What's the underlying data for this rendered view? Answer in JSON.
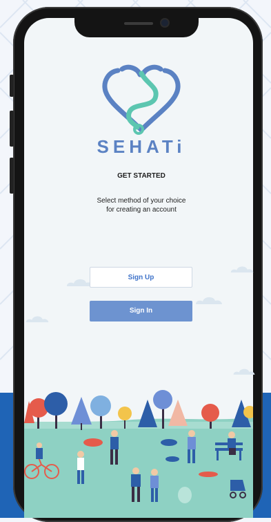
{
  "app": {
    "brand": "SEHATi",
    "title": "GET STARTED",
    "subtitle_line1": "Select method of your choice",
    "subtitle_line2": "for creating an account"
  },
  "buttons": {
    "sign_up": "Sign Up",
    "sign_in": "Sign In"
  },
  "colors": {
    "brand_blue": "#5b82c3",
    "logo_teal": "#5cc6b0",
    "button_primary": "#6d93d0",
    "background_band": "#1f64b6",
    "screen_bg": "#f2f6f8"
  },
  "icons": [
    "heart-stethoscope-logo-icon",
    "park-people-illustration"
  ]
}
